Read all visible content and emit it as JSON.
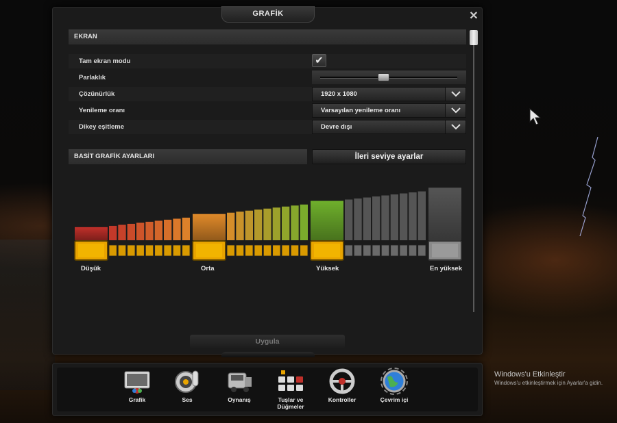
{
  "window": {
    "title": "GRAFİK",
    "close_icon": "close-icon"
  },
  "ekran": {
    "header": "EKRAN",
    "fullscreen": {
      "label": "Tam ekran modu",
      "checked": true
    },
    "brightness": {
      "label": "Parlaklık",
      "level": 0.46
    },
    "resolution": {
      "label": "Çözünürlük",
      "value": "1920 x 1080"
    },
    "refresh": {
      "label": "Yenileme oranı",
      "value": "Varsayılan yenileme oranı"
    },
    "vsync": {
      "label": "Dikey eşitleme",
      "value": "Devre dışı"
    }
  },
  "basit": {
    "header": "BASİT GRAFİK AYARLARI",
    "advanced_button": "İleri seviye ayarlar",
    "levels": [
      {
        "label": "Düşük",
        "color": "#c0302a",
        "active": true
      },
      {
        "label": "Orta",
        "color": "#e08a2a",
        "active": true
      },
      {
        "label": "Yüksek",
        "color": "#6fb02c",
        "active": true
      },
      {
        "label": "En yüksek",
        "color": "#555555",
        "active": false
      }
    ],
    "selected_level": "Yüksek"
  },
  "apply_button": "Uygula",
  "nav": [
    {
      "label": "Grafik",
      "icon": "monitor-icon"
    },
    {
      "label": "Ses",
      "icon": "speaker-icon"
    },
    {
      "label": "Oynanış",
      "icon": "truck-icon"
    },
    {
      "label": "Tuşlar ve\nDüğmeler",
      "icon": "keyboard-icon"
    },
    {
      "label": "Kontroller",
      "icon": "steering-wheel-icon"
    },
    {
      "label": "Çevrim içi",
      "icon": "globe-icon"
    }
  ],
  "os_overlay": {
    "line1": "Windows'u Etkinleştir",
    "line2": "Windows'u etkinleştirmek için Ayarlar'a gidin."
  },
  "colors": {
    "accent": "#e8a400",
    "panel": "#1b1b1b"
  }
}
